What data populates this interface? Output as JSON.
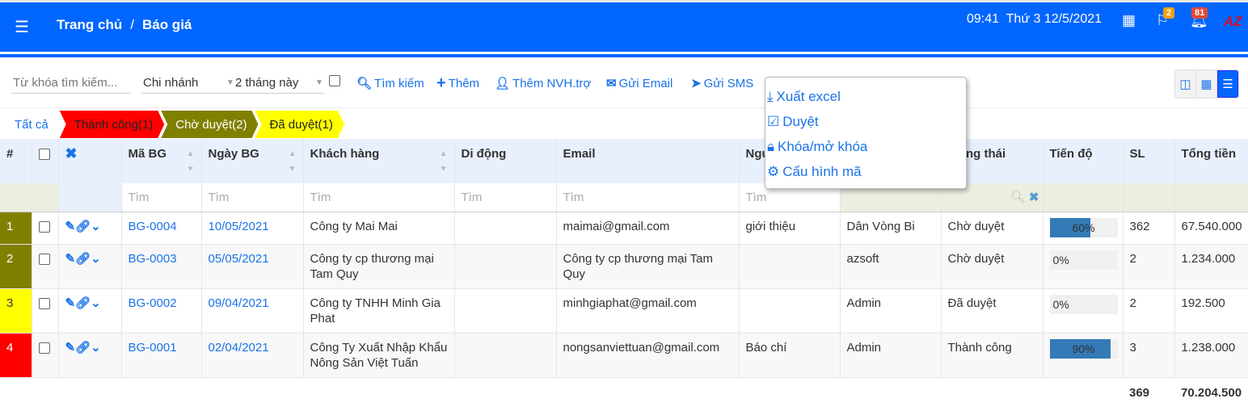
{
  "header": {
    "breadcrumb": [
      "Trang chủ",
      "Báo giá"
    ],
    "time": "09:41",
    "date": "Thứ 3 12/5/2021",
    "flag_badge": "2",
    "bell_badge": "81",
    "logo": "AZ"
  },
  "toolbar": {
    "keyword_placeholder": "Từ khóa tìm kiếm...",
    "branch": "Chi nhánh",
    "period": "2 tháng này",
    "search": "Tìm kiếm",
    "add": "Thêm",
    "add_supporter": "Thêm NVH.trợ",
    "send_email": "Gửi Email",
    "send_sms": "Gửi SMS"
  },
  "dropdown": [
    "Xuất excel",
    "Duyệt",
    "Khóa/mở khóa",
    "Cấu hình mã"
  ],
  "status_tabs": [
    {
      "label": "Tất cả"
    },
    {
      "label": "Thành công(1)",
      "color": "#ff0000"
    },
    {
      "label": "Chờ duyệt(2)",
      "color": "#808000"
    },
    {
      "label": "Đã duyệt(1)",
      "color": "#ffff00"
    }
  ],
  "columns": [
    "#",
    "",
    "",
    "Mã BG",
    "Ngày BG",
    "Khách hàng",
    "Di động",
    "Email",
    "Nguồn",
    "",
    "Trạng thái",
    "Tiến độ",
    "SL",
    "Tổng tiền"
  ],
  "filter_placeholder": "Tìm",
  "rows": [
    {
      "no": "1",
      "color": "#808000",
      "code": "BG-0004",
      "date": "10/05/2021",
      "customer": "Công ty Mai Mai",
      "mobile": "",
      "email": "maimai@gmail.com",
      "source": "giới thiệu",
      "staff": "Dân Vòng Bi",
      "status": "Chờ duyệt",
      "progress": 60,
      "progress_label": "60%",
      "qty": "362",
      "total": "67.540.000"
    },
    {
      "no": "2",
      "color": "#808000",
      "code": "BG-0003",
      "date": "05/05/2021",
      "customer": "Công ty cp thương mại Tam Quy",
      "mobile": "",
      "email": "Công ty cp thương mại Tam Quy",
      "source": "",
      "staff": "azsoft",
      "status": "Chờ duyệt",
      "progress": 0,
      "progress_label": "0%",
      "qty": "2",
      "total": "1.234.000"
    },
    {
      "no": "3",
      "color": "#ffff00",
      "code": "BG-0002",
      "date": "09/04/2021",
      "customer": "Công ty TNHH Minh Gia Phat",
      "mobile": "",
      "email": "minhgiaphat@gmail.com",
      "source": "",
      "staff": "Admin",
      "status": "Đã duyệt",
      "progress": 0,
      "progress_label": "0%",
      "qty": "2",
      "total": "192.500"
    },
    {
      "no": "4",
      "color": "#ff0000",
      "code": "BG-0001",
      "date": "02/04/2021",
      "customer": "Công Ty Xuất Nhập Khẩu Nông Sản Việt Tuấn",
      "mobile": "",
      "email": "nongsanviettuan@gmail.com",
      "source": "Báo chí",
      "staff": "Admin",
      "status": "Thành công",
      "progress": 90,
      "progress_label": "90%",
      "qty": "3",
      "total": "1.238.000"
    }
  ],
  "totals": {
    "qty": "369",
    "total": "70.204.500"
  }
}
